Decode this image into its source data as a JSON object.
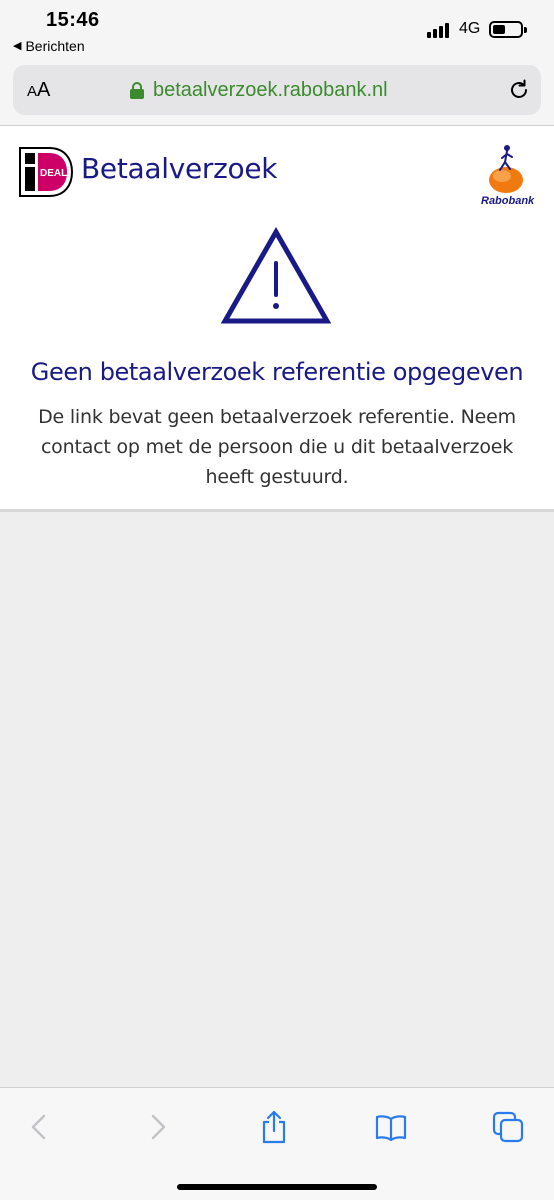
{
  "status_bar": {
    "time": "15:46",
    "back_app_label": "Berichten",
    "network": "4G",
    "battery_level": 0.35
  },
  "url_bar": {
    "text_size_button": "AA",
    "url": "betaalverzoek.rabobank.nl",
    "secure_color": "#3c8a2e"
  },
  "page": {
    "header_title": "Betaalverzoek",
    "ideal_logo_text": "iDEAL",
    "bank_name": "Rabobank",
    "error_title": "Geen betaalverzoek referentie opgegeven",
    "error_message": "De link bevat geen betaalverzoek referentie. Neem contact op met de persoon die u dit betaalverzoek heeft gestuurd.",
    "brand_color": "#1a1a86"
  },
  "toolbar": {
    "icons": [
      "back-arrow-icon",
      "forward-arrow-icon",
      "share-icon",
      "bookmarks-icon",
      "tabs-icon"
    ],
    "active_color": "#2b7bea",
    "disabled_color": "#c4c4c8"
  }
}
